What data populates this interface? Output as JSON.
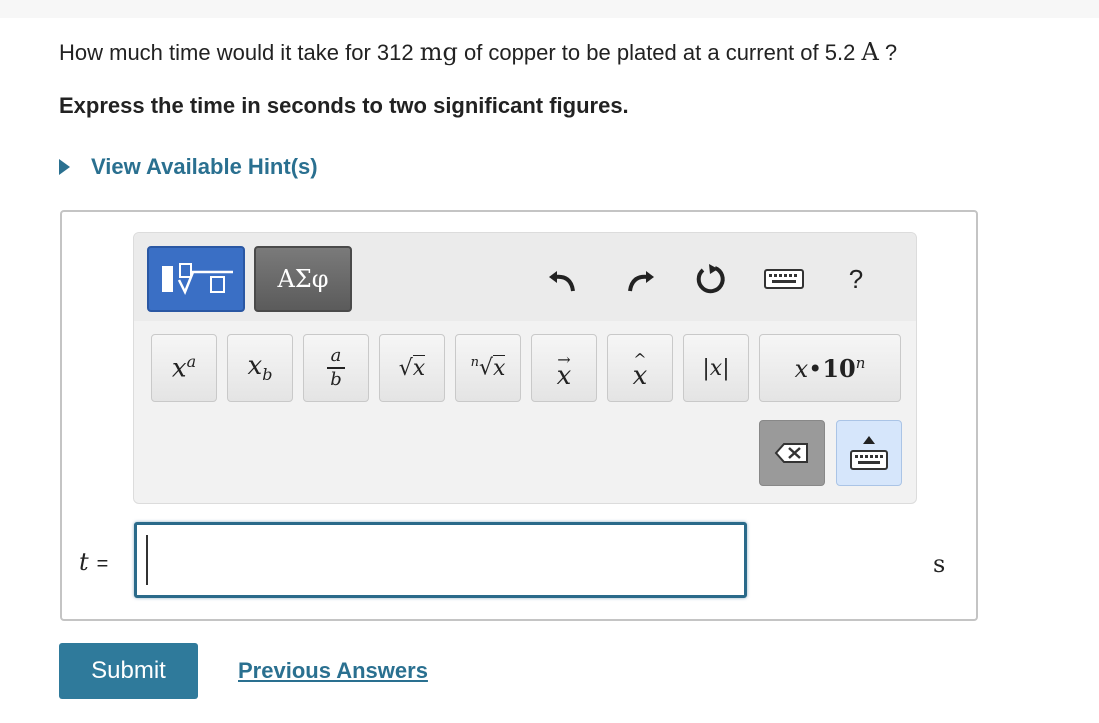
{
  "question": {
    "prefix": "How much time would it take for 312 ",
    "mass_unit": "mg",
    "middle": " of copper to be plated at a current of 5.2 ",
    "current_unit": "A",
    "suffix": " ?"
  },
  "instruction": "Express the time in seconds to two significant figures.",
  "hint_link": "View Available Hint(s)",
  "toolbar": {
    "greek_label": "ΑΣφ",
    "help_label": "?",
    "keys": [
      {
        "name": "superscript-key",
        "label": "xᵃ"
      },
      {
        "name": "subscript-key",
        "label": "x_b"
      },
      {
        "name": "fraction-key",
        "label": "a/b"
      },
      {
        "name": "sqrt-key",
        "label": "√x"
      },
      {
        "name": "nth-root-key",
        "label": "ⁿ√x"
      },
      {
        "name": "vector-key",
        "label": "x⃗"
      },
      {
        "name": "hat-key",
        "label": "x̂"
      },
      {
        "name": "abs-key",
        "label": "|x|"
      },
      {
        "name": "sci-notation-key",
        "label": "x•10ⁿ"
      }
    ]
  },
  "answer": {
    "variable": "t",
    "equals": "=",
    "value": "",
    "unit": "s"
  },
  "actions": {
    "submit_label": "Submit",
    "previous_label": "Previous Answers"
  },
  "colors": {
    "link": "#2a7090",
    "submit_bg": "#2f7a9b",
    "template_button": "#3a6fc5"
  }
}
